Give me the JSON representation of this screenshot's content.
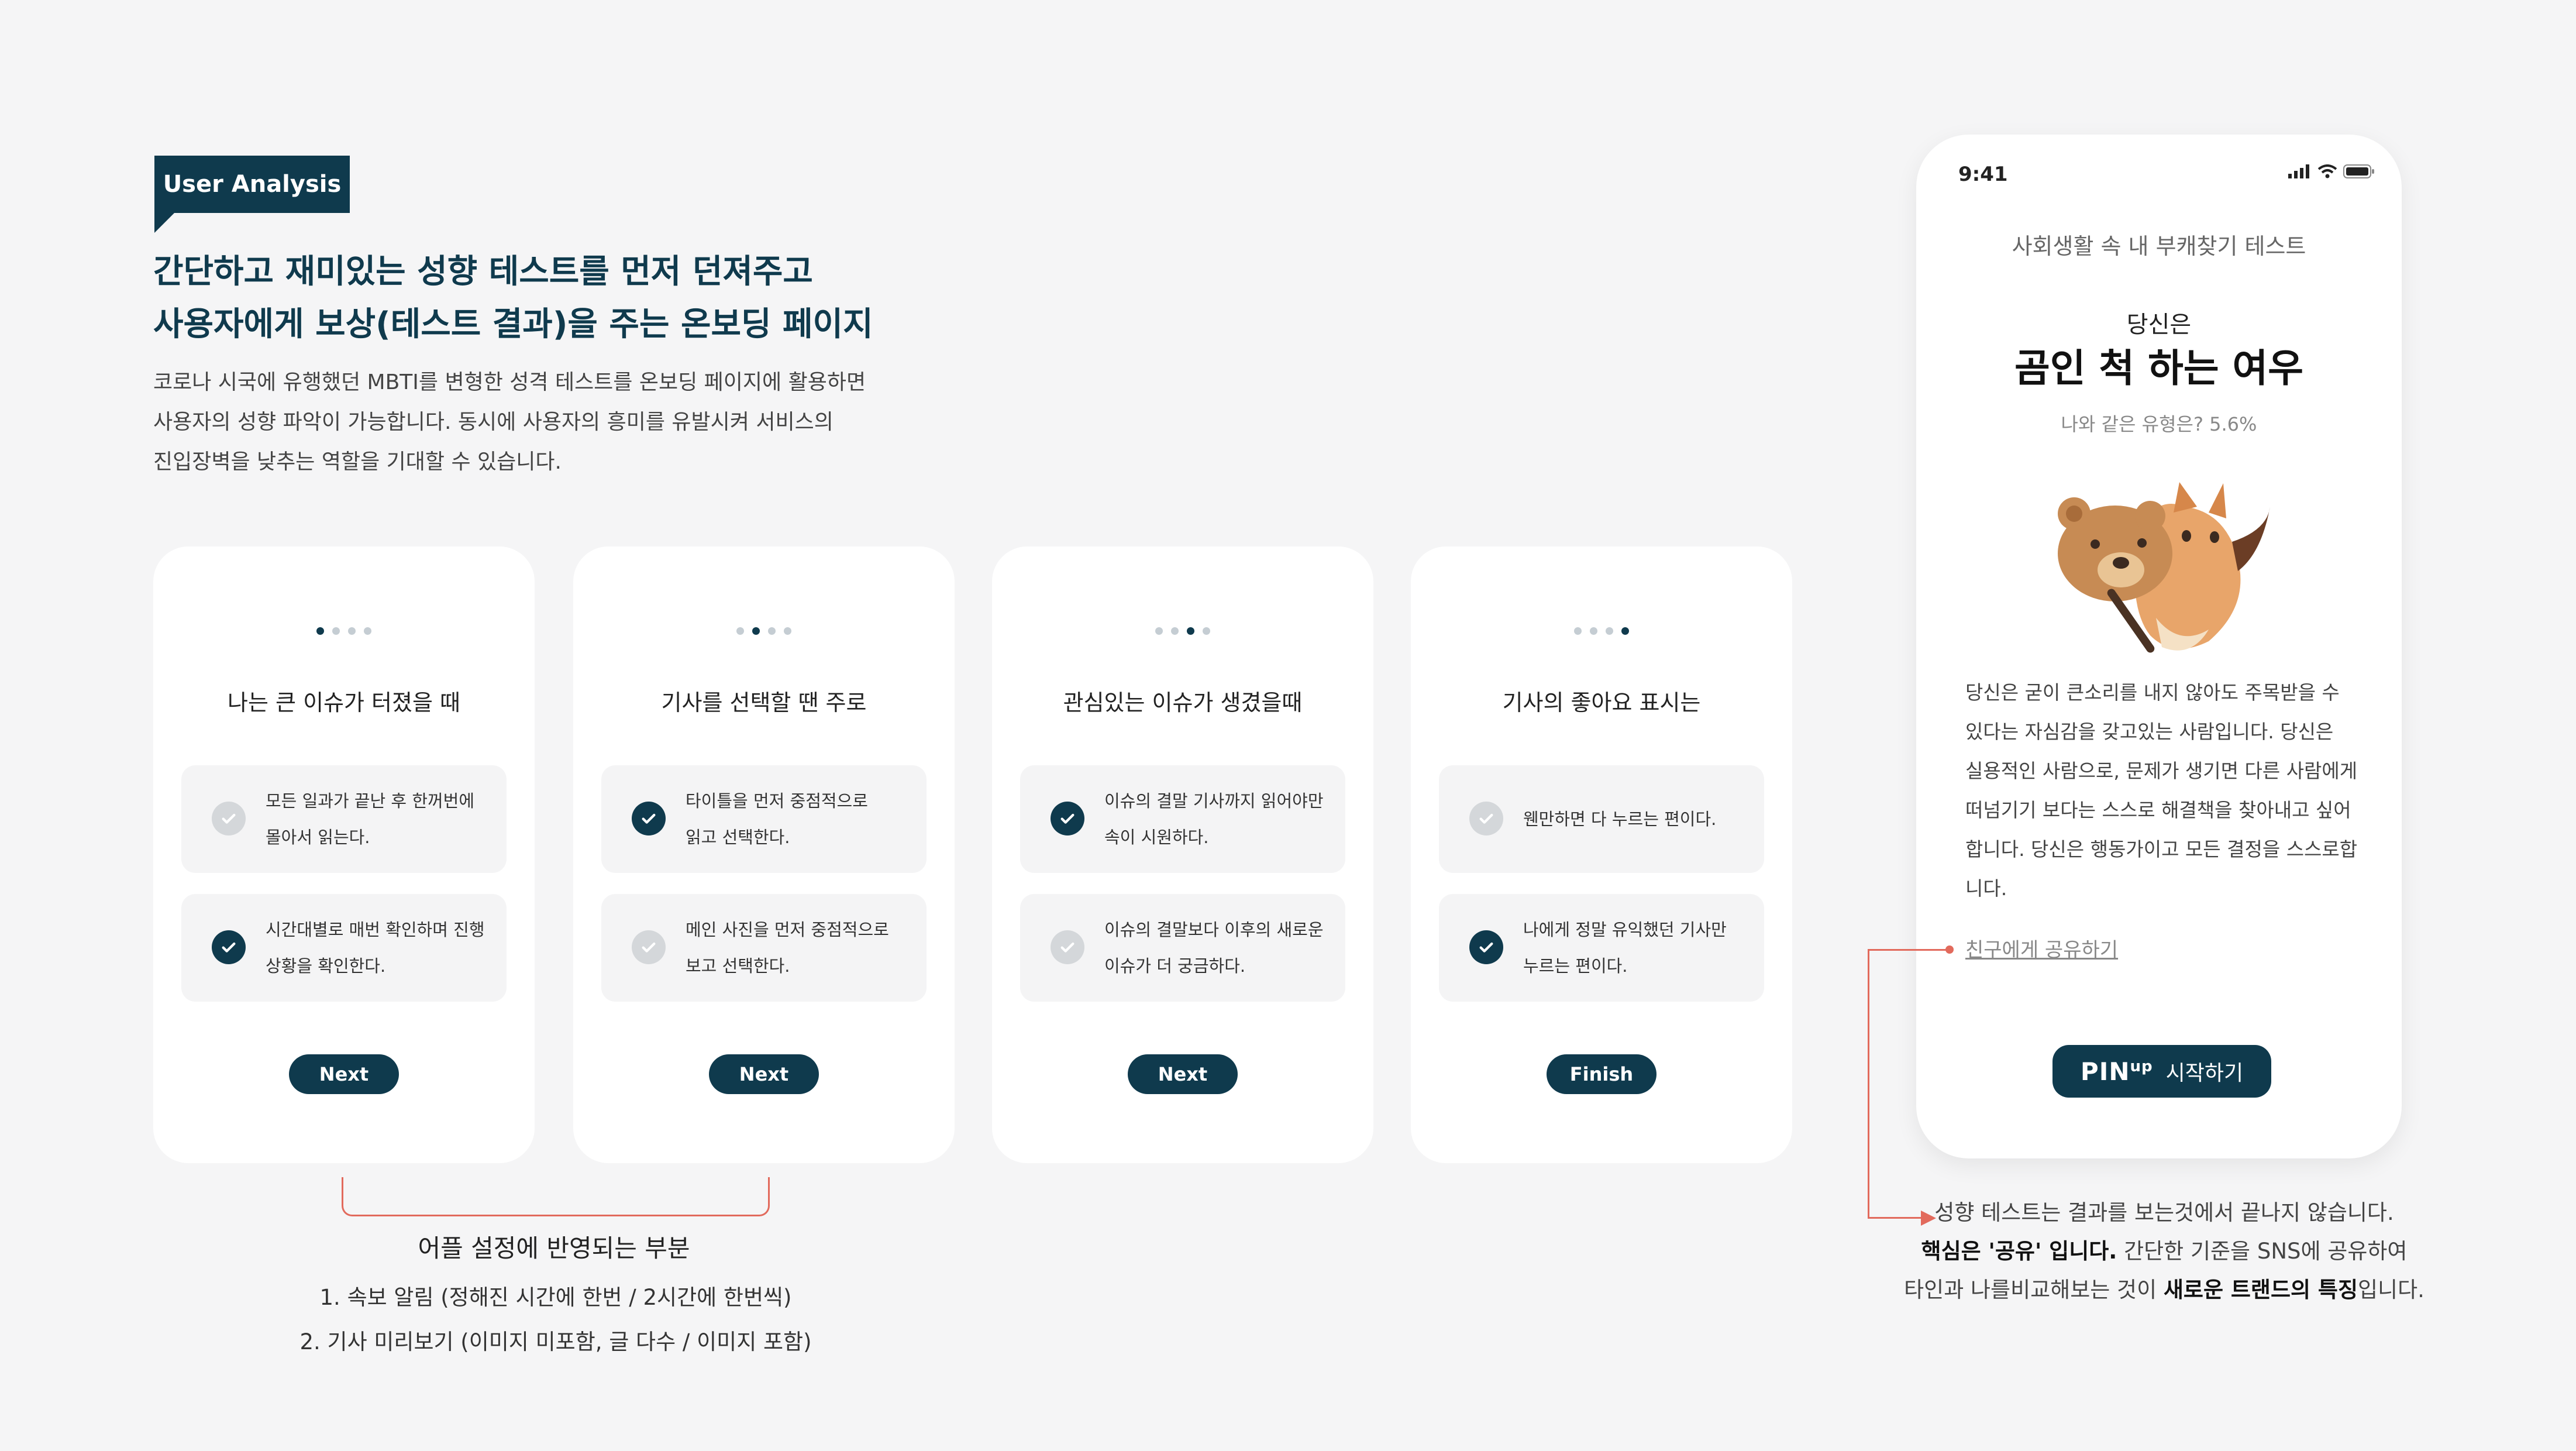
{
  "header": {
    "tag": "User Analysis",
    "headline_1": "간단하고 재미있는 성향 테스트를 먼저 던져주고",
    "headline_2": "사용자에게 보상(테스트 결과)을 주는 온보딩 페이지",
    "desc_1": "코로나 시국에 유행했던 MBTI를 변형한 성격 테스트를 온보딩 페이지에 활용하면",
    "desc_2": "사용자의 성향 파악이 가능합니다. 동시에 사용자의 흥미를 유발시켜 서비스의",
    "desc_3": "진입장벽을 낮추는 역할을 기대할 수 있습니다."
  },
  "cards": [
    {
      "active_step": 1,
      "question": "나는 큰 이슈가 터졌을 때",
      "options": [
        {
          "line1": "모든 일과가 끝난 후 한꺼번에",
          "line2": "몰아서 읽는다.",
          "checked": false
        },
        {
          "line1": "시간대별로 매번 확인하며 진행",
          "line2": "상황을 확인한다.",
          "checked": true
        }
      ],
      "button": "Next"
    },
    {
      "active_step": 2,
      "question": "기사를 선택할 땐 주로",
      "options": [
        {
          "line1": "타이틀을 먼저 중점적으로",
          "line2": "읽고 선택한다.",
          "checked": true
        },
        {
          "line1": "메인 사진을 먼저 중점적으로",
          "line2": "보고 선택한다.",
          "checked": false
        }
      ],
      "button": "Next"
    },
    {
      "active_step": 3,
      "question": "관심있는 이슈가 생겼을때",
      "options": [
        {
          "line1": "이슈의 결말 기사까지 읽어야만",
          "line2": "속이 시원하다.",
          "checked": true
        },
        {
          "line1": "이슈의 결말보다 이후의 새로운",
          "line2": "이슈가 더 궁금하다.",
          "checked": false
        }
      ],
      "button": "Next"
    },
    {
      "active_step": 4,
      "question": "기사의 좋아요 표시는",
      "options": [
        {
          "line1": "웬만하면 다 누르는 편이다.",
          "line2": "",
          "checked": false
        },
        {
          "line1": "나에게 정말 유익했던 기사만",
          "line2": "누르는 편이다.",
          "checked": true
        }
      ],
      "button": "Finish"
    }
  ],
  "settings_note": {
    "title": "어플 설정에 반영되는 부분",
    "item_1": "1. 속보 알림 (정해진 시간에 한번 / 2시간에 한번씩)",
    "item_2": "2. 기사 미리보기 (이미지 미포함, 글 다수 / 이미지 포함)"
  },
  "phone": {
    "time": "9:41",
    "subtitle": "사회생활 속 내 부캐찾기 테스트",
    "lead": "당신은",
    "result": "곰인 척 하는 여우",
    "same_type": "나와 같은 유형은?  5.6%",
    "body_1": "당신은 굳이 큰소리를 내지 않아도 주목받을 수",
    "body_2": "있다는 자심감을 갖고있는 사람입니다.  당신은",
    "body_3": "실용적인 사람으로, 문제가 생기면 다른 사람에게",
    "body_4": "떠넘기기 보다는 스스로 해결책을 찾아내고 싶어",
    "body_5": "합니다. 당신은 행동가이고 모든 결정을 스스로합",
    "body_6": "니다.",
    "share": "친구에게 공유하기",
    "cta_logo": "PIN",
    "cta_logo_sup": "up",
    "cta_label": "시작하기"
  },
  "right_note": {
    "line_1": "성향 테스트는 결과를 보는것에서 끝나지 않습니다.",
    "line_2_bold": "핵심은 '공유' 입니다.",
    "line_2_rest": " 간단한 기준을 SNS에 공유하여",
    "line_3_pre": "타인과 나를비교해보는 것이 ",
    "line_3_bold": "새로운 트랜드의 특징",
    "line_3_post": "입니다."
  },
  "colors": {
    "primary": "#0f3a4d",
    "accent": "#e26a5c",
    "background": "#f5f5f6"
  }
}
